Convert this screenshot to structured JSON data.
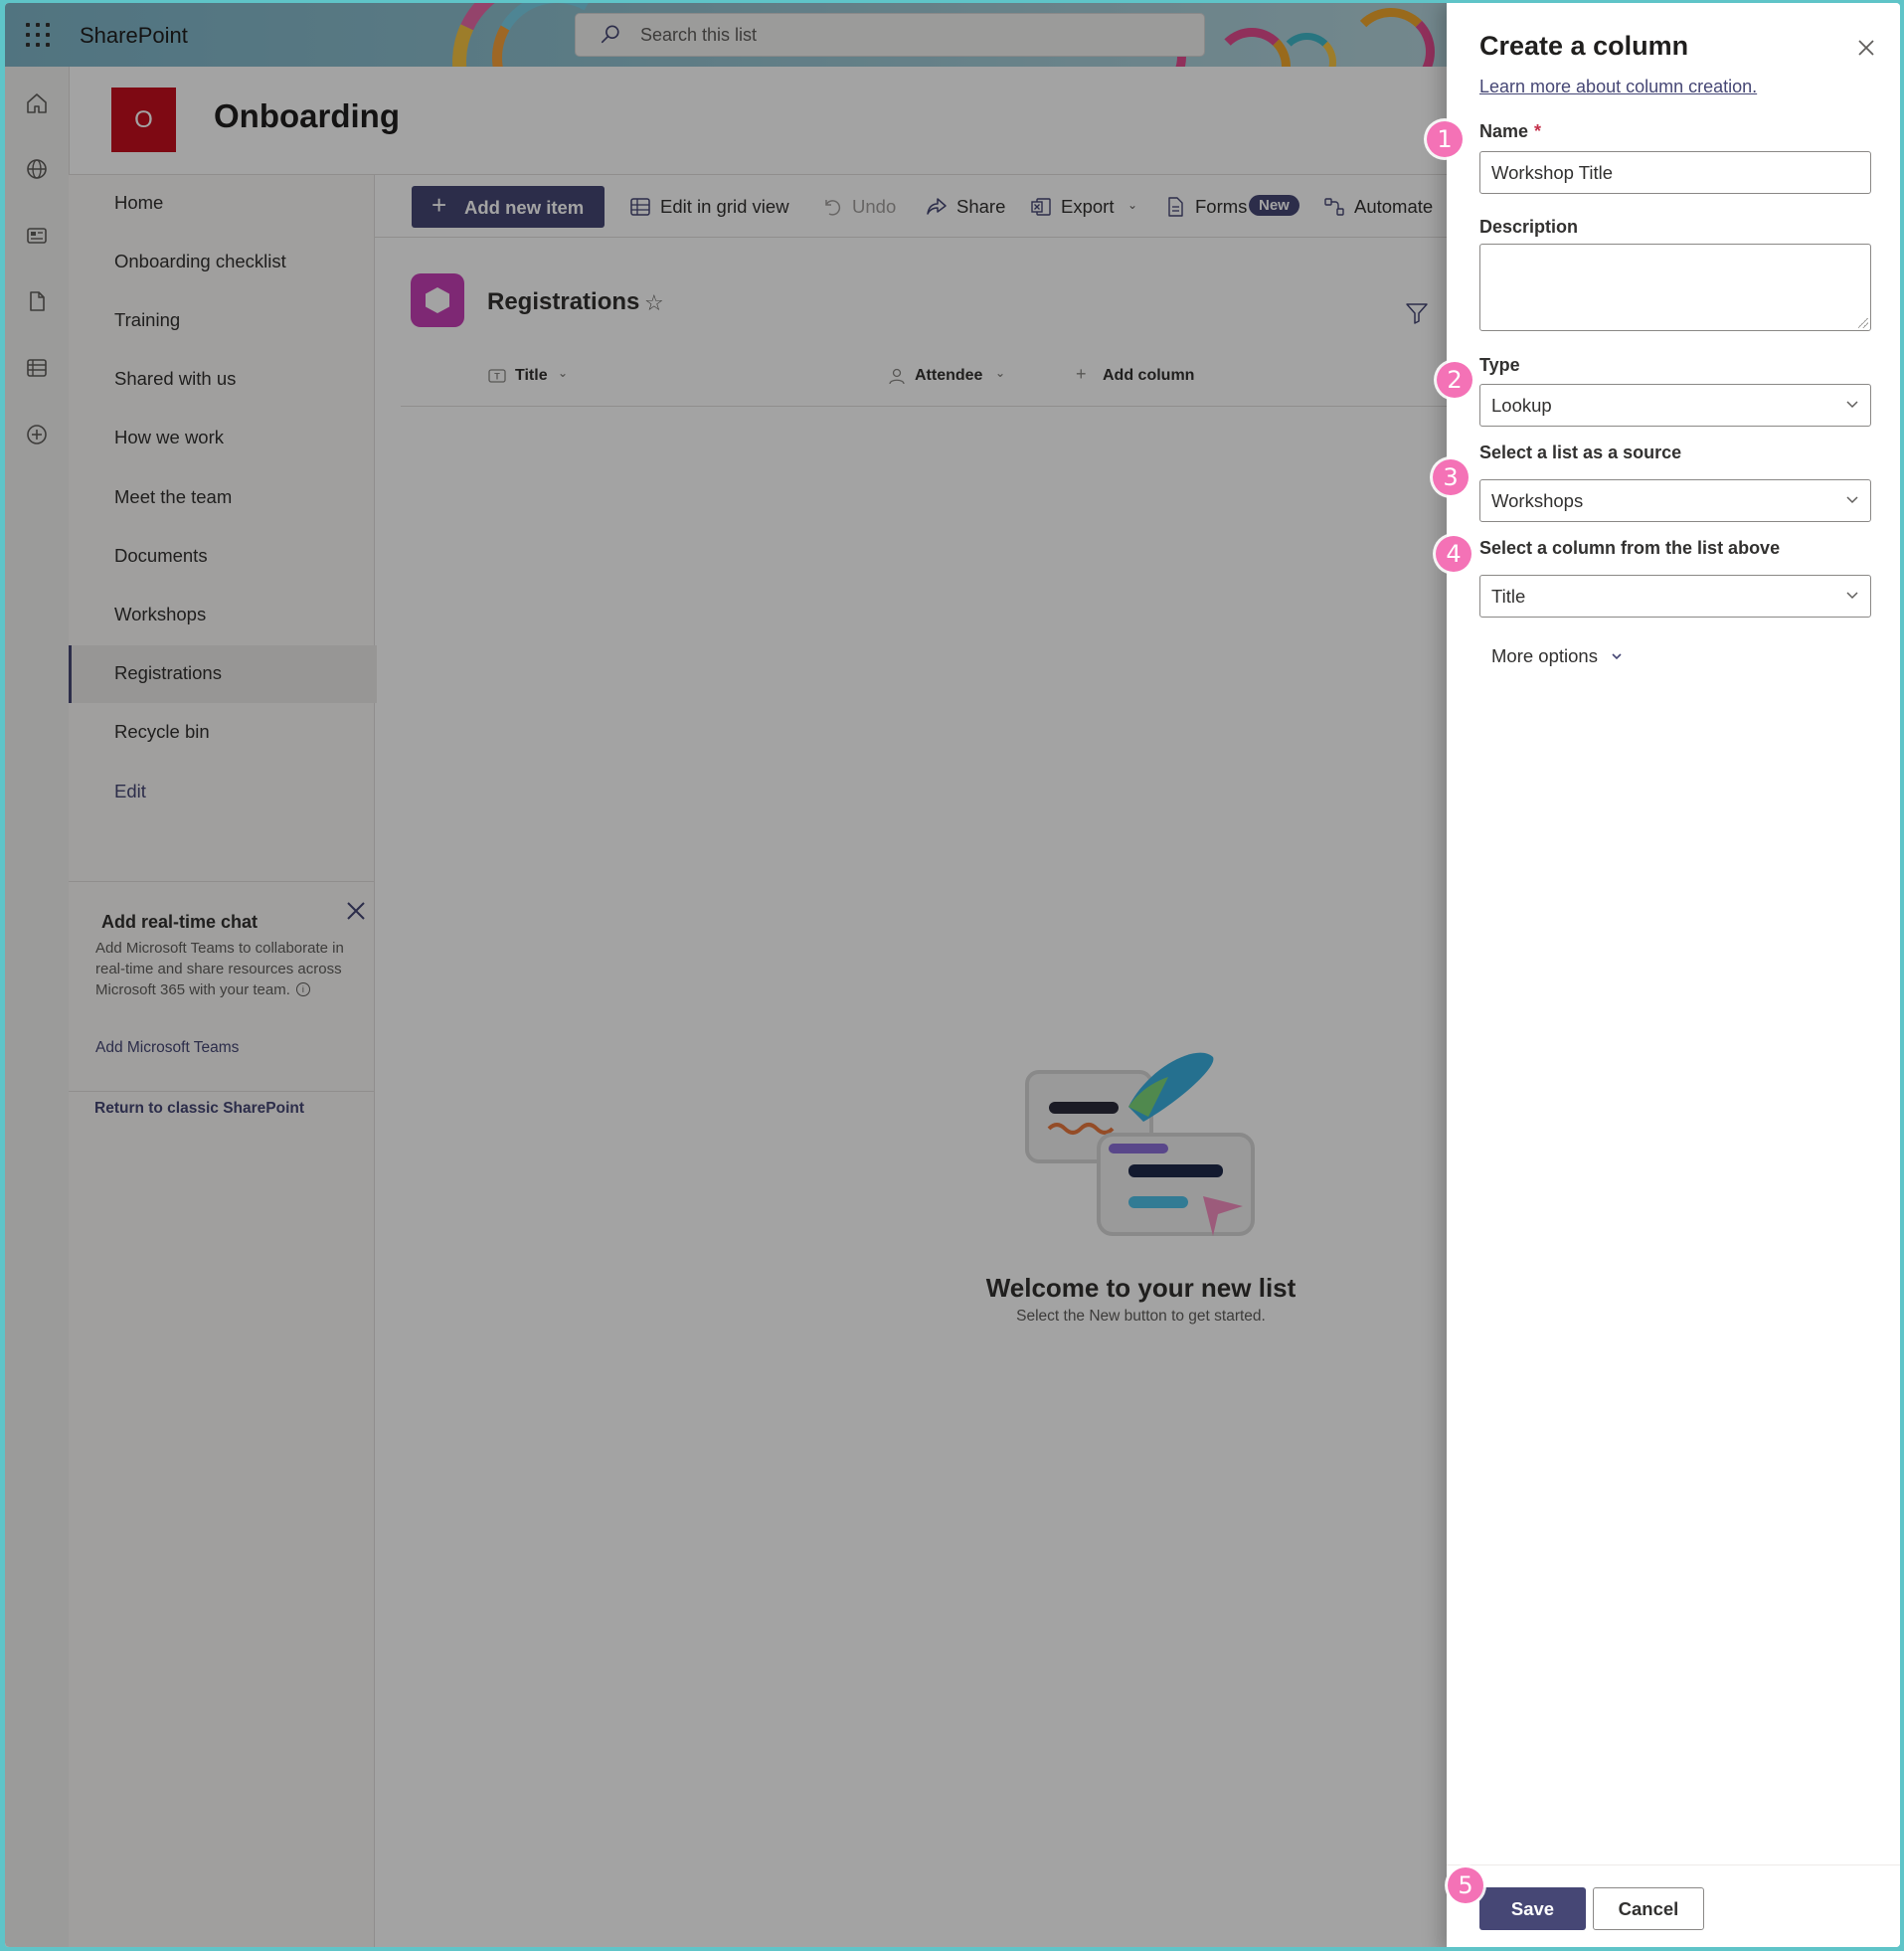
{
  "app": {
    "brand": "SharePoint"
  },
  "search": {
    "placeholder": "Search this list"
  },
  "site": {
    "logo_letter": "O",
    "title": "Onboarding"
  },
  "leftnav": {
    "items": [
      {
        "label": "Home"
      },
      {
        "label": "Onboarding checklist"
      },
      {
        "label": "Training"
      },
      {
        "label": "Shared with us"
      },
      {
        "label": "How we work"
      },
      {
        "label": "Meet the team"
      },
      {
        "label": "Documents"
      },
      {
        "label": "Workshops"
      },
      {
        "label": "Registrations",
        "active": true
      },
      {
        "label": "Recycle bin"
      },
      {
        "label": "Edit"
      }
    ],
    "chat": {
      "title": "Add real-time chat",
      "body": "Add Microsoft Teams to collaborate in real-time and share resources across Microsoft 365 with your team.",
      "link": "Add Microsoft Teams"
    },
    "classic_link": "Return to classic SharePoint"
  },
  "commandbar": {
    "add_new_item": "Add new item",
    "edit_grid": "Edit in grid view",
    "undo": "Undo",
    "share": "Share",
    "export": "Export",
    "forms": "Forms",
    "new_badge": "New",
    "automate": "Automate"
  },
  "list": {
    "title": "Registrations",
    "columns": [
      "Title",
      "Attendee"
    ],
    "add_column": "Add column",
    "empty_title": "Welcome to your new list",
    "empty_subtitle": "Select the New button to get started."
  },
  "panel": {
    "title": "Create a column",
    "learn_more": "Learn more about column creation.",
    "name_label": "Name",
    "name_required_mark": "*",
    "name_value": "Workshop Title",
    "description_label": "Description",
    "description_value": "",
    "type_label": "Type",
    "type_value": "Lookup",
    "source_label": "Select a list as a source",
    "source_value": "Workshops",
    "column_label": "Select a column from the list above",
    "column_value": "Title",
    "more_options": "More options",
    "save": "Save",
    "cancel": "Cancel"
  },
  "steps": [
    "1",
    "2",
    "3",
    "4",
    "5"
  ],
  "colors": {
    "accent": "#464775",
    "site_logo": "#c50f1f",
    "step_marker": "#f472b6",
    "required": "#c4314b"
  }
}
